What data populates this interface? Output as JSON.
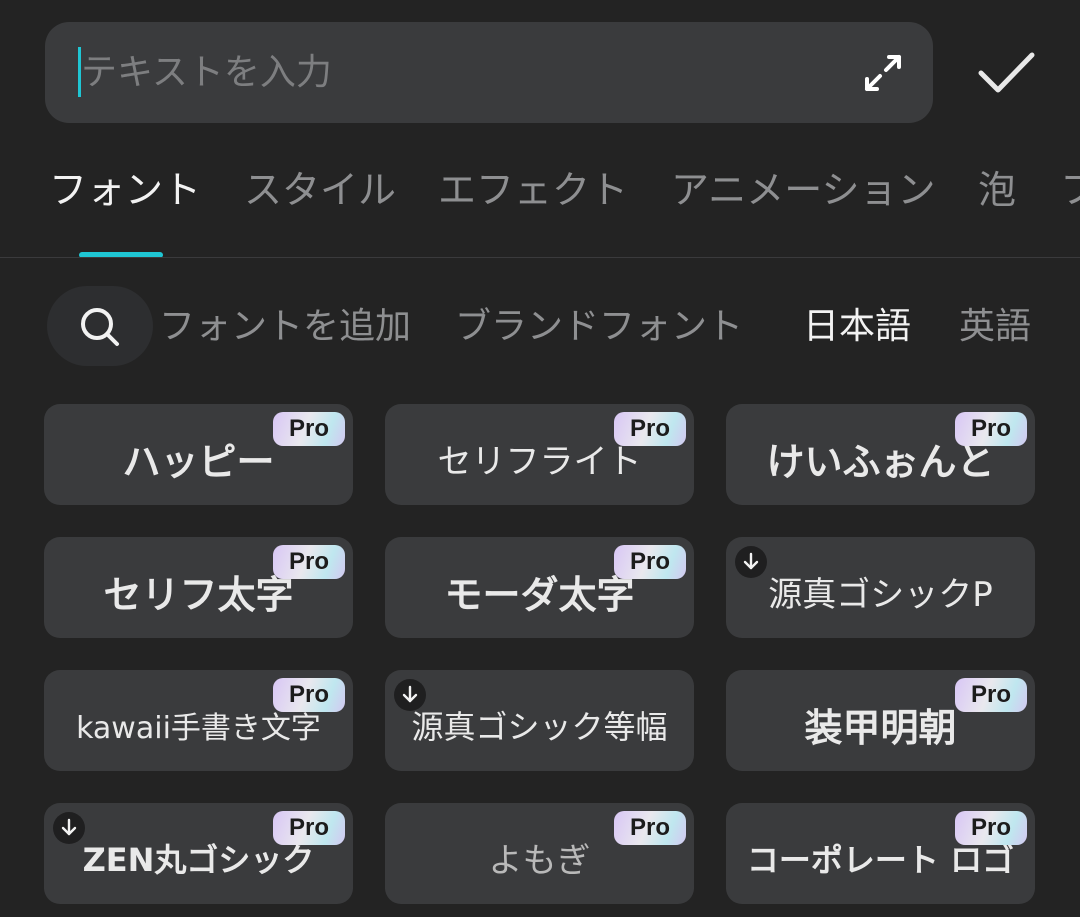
{
  "input": {
    "placeholder": "テキストを入力"
  },
  "icons": {
    "expand": "expand-icon",
    "confirm": "checkmark-icon",
    "search": "search-icon",
    "download": "download-arrow-icon"
  },
  "colors": {
    "accent": "#1fc6d4",
    "background": "#232323",
    "card": "#3a3b3d"
  },
  "tabs": [
    {
      "label": "フォント",
      "active": true
    },
    {
      "label": "スタイル"
    },
    {
      "label": "エフェクト"
    },
    {
      "label": "アニメーション"
    },
    {
      "label": "泡"
    },
    {
      "label": "フ"
    }
  ],
  "categories": [
    {
      "label": "フォントを追加"
    },
    {
      "label": "ブランドフォント"
    },
    {
      "label": "日本語",
      "active": true
    },
    {
      "label": "英語"
    }
  ],
  "fonts": [
    {
      "name": "ハッピー",
      "pro": "Pro"
    },
    {
      "name": "セリフライト",
      "pro": "Pro"
    },
    {
      "name": "けいふぉんと",
      "pro": "Pro"
    },
    {
      "name": "セリフ太字",
      "pro": "Pro"
    },
    {
      "name": "モーダ太字",
      "pro": "Pro"
    },
    {
      "name": "源真ゴシックP"
    },
    {
      "name": "kawaii手書き文字",
      "pro": "Pro"
    },
    {
      "name": "源真ゴシック等幅"
    },
    {
      "name": "装甲明朝",
      "pro": "Pro"
    },
    {
      "name": "ZEN丸ゴシック",
      "pro": "Pro"
    },
    {
      "name": "よもぎ",
      "pro": "Pro"
    },
    {
      "name": "コーポレート ロゴ",
      "pro": "Pro"
    }
  ]
}
